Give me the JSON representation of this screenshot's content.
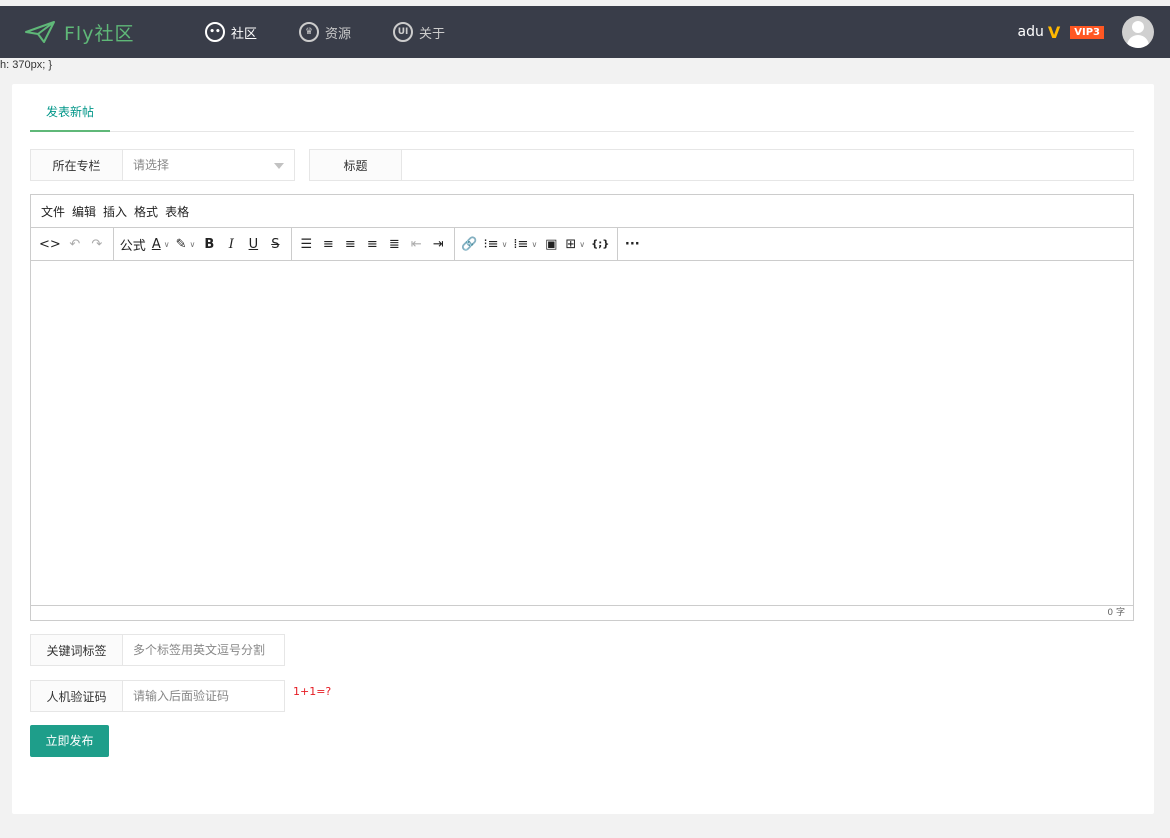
{
  "header": {
    "logo_text": "Fly社区",
    "nav": [
      {
        "label": "社区",
        "icon": "chat-bubble-icon"
      },
      {
        "label": "资源",
        "icon": "crown-icon"
      },
      {
        "label": "关于",
        "icon": "ui-badge-icon"
      }
    ],
    "user": {
      "name": "adu",
      "verify_mark": "V",
      "vip_badge": "VIP3"
    }
  },
  "stray_text": "h: 370px; }",
  "tabs": [
    {
      "label": "发表新帖",
      "active": true
    }
  ],
  "form": {
    "column": {
      "label": "所在专栏",
      "placeholder": "请选择"
    },
    "title": {
      "label": "标题",
      "value": ""
    },
    "keywords": {
      "label": "关键词标签",
      "placeholder": "多个标签用英文逗号分割"
    },
    "captcha": {
      "label": "人机验证码",
      "placeholder": "请输入后面验证码",
      "question": "1+1=?"
    },
    "submit_label": "立即发布"
  },
  "editor": {
    "menus": [
      "文件",
      "编辑",
      "插入",
      "格式",
      "表格"
    ],
    "formula_label": "公式",
    "bold": "B",
    "italic": "I",
    "underline": "U",
    "strike": "S",
    "code_sample": "{;}",
    "more": "···",
    "word_count": "0 字"
  },
  "colors": {
    "topbar": "#393d49",
    "accent": "#009688",
    "logo": "#5fb878",
    "vip": "#ff5722",
    "verify": "#ffb800",
    "hint": "#e51c23"
  }
}
